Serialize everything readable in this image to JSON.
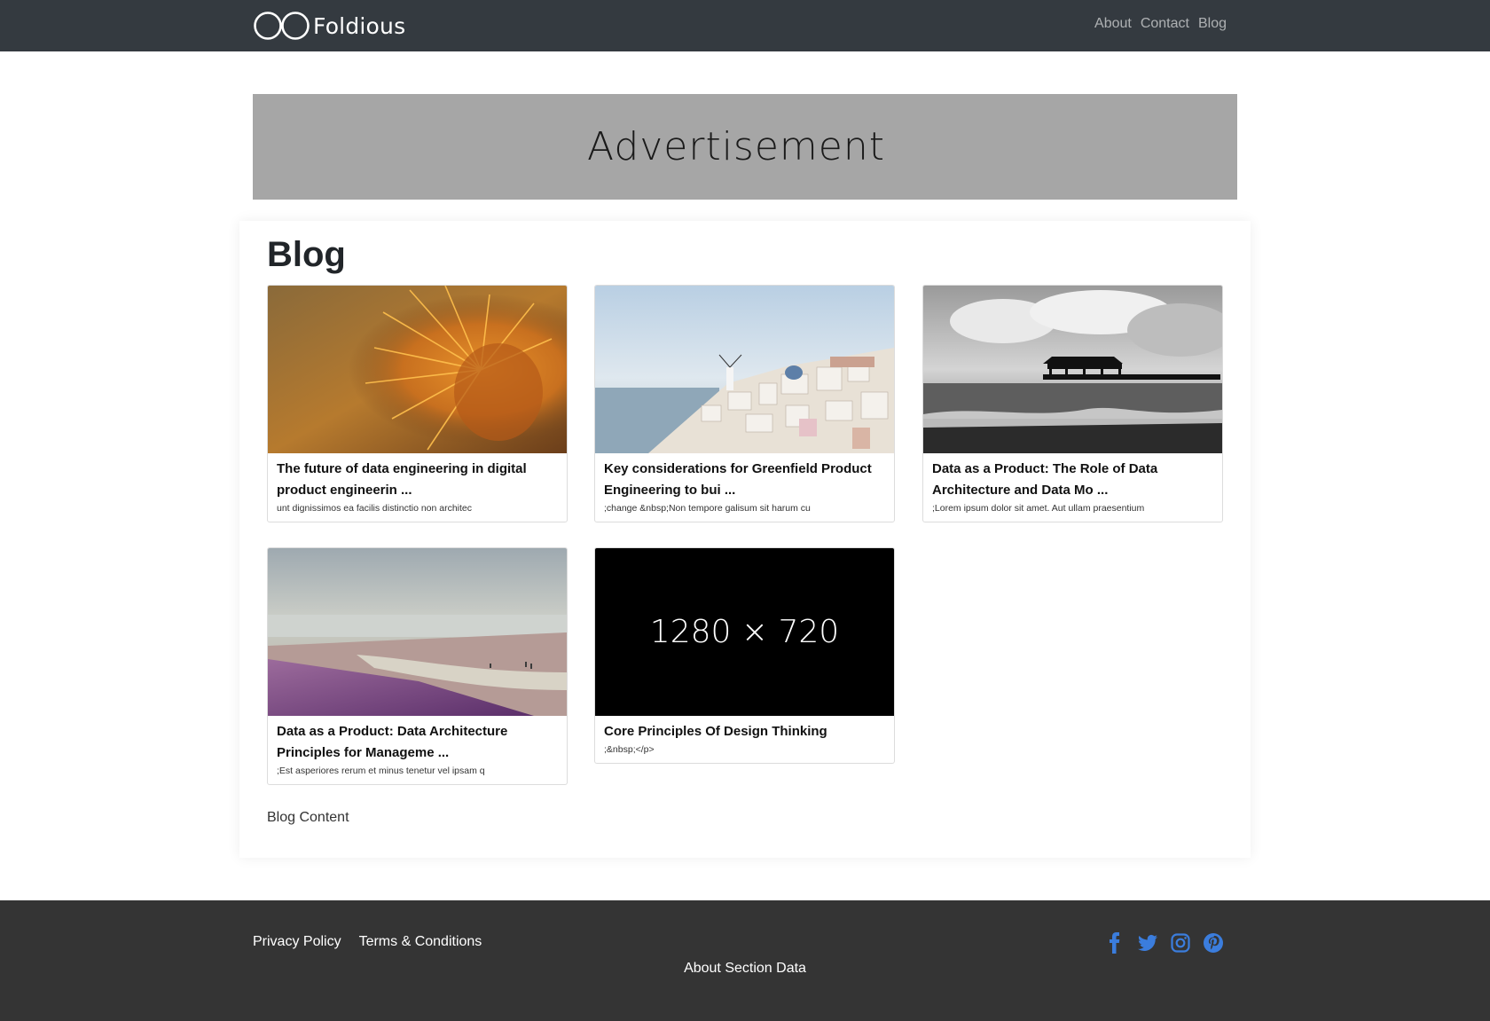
{
  "navbar": {
    "brand": "Foldious",
    "links": [
      {
        "label": "About"
      },
      {
        "label": "Contact"
      },
      {
        "label": "Blog"
      }
    ]
  },
  "ad": {
    "label": "Advertisement"
  },
  "blog": {
    "title": "Blog",
    "posts": [
      {
        "title": "The future of data engineering in digital product engineerin ...",
        "excerpt": "unt dignissimos ea facilis distinctio non architec",
        "image": "orange cactus spines close-up"
      },
      {
        "title": "Key considerations for Greenfield Product Engineering to bui ...",
        "excerpt": ";change &nbsp;Non tempore galisum sit harum cu",
        "image": "white hillside village by the sea"
      },
      {
        "title": "Data as a Product: The Role of Data Architecture and Data Mo ...",
        "excerpt": ";Lorem ipsum dolor sit amet. Aut ullam praesentium",
        "image": "black and white pier with waves"
      },
      {
        "title": "Data as a Product: Data Architecture Principles for Manageme ...",
        "excerpt": ";Est asperiores rerum et minus tenetur vel ipsam q",
        "image": "purple beach at low tide"
      },
      {
        "title": "Core Principles Of Design Thinking",
        "excerpt": ";&nbsp;</p>",
        "image": "1280 × 720 placeholder",
        "placeholder_text": "1280 × 720"
      }
    ],
    "content_label": "Blog Content"
  },
  "footer": {
    "links": [
      {
        "label": "Privacy Policy"
      },
      {
        "label": "Terms & Conditions"
      }
    ],
    "about": "About Section Data",
    "social": [
      "facebook-icon",
      "twitter-icon",
      "instagram-icon",
      "pinterest-icon"
    ],
    "social_color": "#3b7ddd"
  },
  "colors": {
    "navbar": "#343a40",
    "footer": "#343434",
    "ad_background": "#a6a6a6"
  }
}
